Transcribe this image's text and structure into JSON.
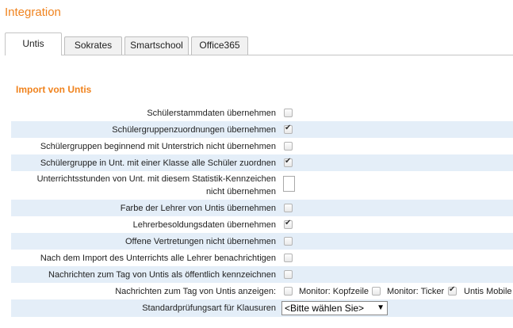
{
  "page": {
    "title": "Integration"
  },
  "tabs": [
    {
      "label": "Untis",
      "active": true
    },
    {
      "label": "Sokrates",
      "active": false
    },
    {
      "label": "Smartschool",
      "active": false
    },
    {
      "label": "Office365",
      "active": false
    }
  ],
  "section": {
    "title": "Import von Untis"
  },
  "rows": [
    {
      "label": "Schülerstammdaten übernehmen",
      "checked": false
    },
    {
      "label": "Schülergruppenzuordnungen übernehmen",
      "checked": true
    },
    {
      "label": "Schülergruppen beginnend mit Unterstrich nicht übernehmen",
      "checked": false
    },
    {
      "label": "Schülergruppe in Unt. mit einer Klasse alle Schüler zuordnen",
      "checked": true
    },
    {
      "label_line1": "Unterrichtsstunden von Unt. mit diesem Statistik-Kennzeichen",
      "label_line2": "nicht übernehmen",
      "value": ""
    },
    {
      "label": "Farbe der Lehrer von Untis übernehmen",
      "checked": false
    },
    {
      "label": "Lehrerbesoldungsdaten übernehmen",
      "checked": true
    },
    {
      "label": "Offene Vertretungen nicht übernehmen",
      "checked": false
    },
    {
      "label": "Nach dem Import des Unterrichts alle Lehrer benachrichtigen",
      "checked": false
    },
    {
      "label": "Nachrichten zum Tag von Untis als öffentlich kennzeichnen",
      "checked": false
    },
    {
      "label": "Nachrichten zum Tag von Untis anzeigen:",
      "options": [
        {
          "label": "Monitor: Kopfzeile",
          "checked": false
        },
        {
          "label": "Monitor: Ticker",
          "checked": false
        },
        {
          "label": "Untis Mobile",
          "checked": true
        }
      ]
    },
    {
      "label": "Standardprüfungsart für Klausuren",
      "select_value": "<Bitte wählen Sie>"
    }
  ]
}
